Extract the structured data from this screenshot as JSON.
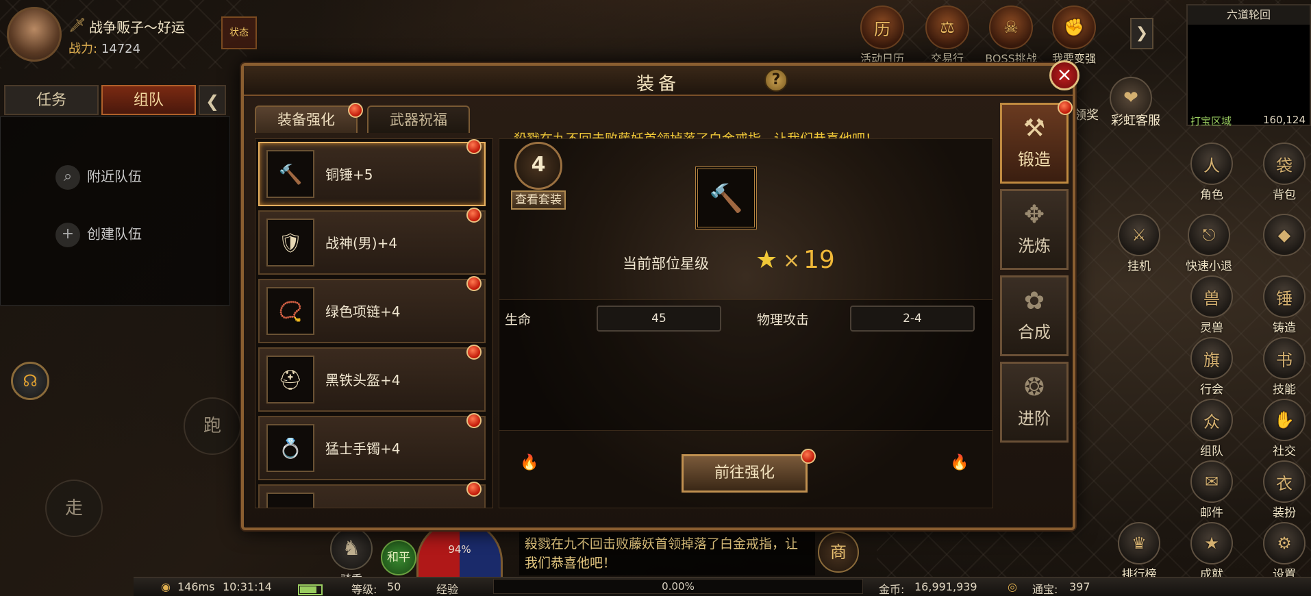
{
  "player": {
    "name": "战争贩子～好运",
    "power_label": "战力:",
    "power_value": "14724",
    "state_label": "状态"
  },
  "left_panel": {
    "tabs": [
      "任务",
      "组队"
    ],
    "collapse_icon": "chevron-left-icon",
    "team_actions": [
      {
        "icon": "search-icon",
        "label": "附近队伍"
      },
      {
        "icon": "plus-icon",
        "label": "创建队伍"
      }
    ],
    "run_label": "跑",
    "walk_label": "走"
  },
  "top_menu": [
    {
      "label": "活动日历",
      "icon": "calendar-icon"
    },
    {
      "label": "交易行",
      "icon": "scale-icon"
    },
    {
      "label": "BOSS挑战",
      "icon": "boss-icon"
    },
    {
      "label": "我要变强",
      "icon": "fist-icon"
    }
  ],
  "side_shortcuts_top": [
    {
      "label": "领奖"
    },
    {
      "label": "彩虹客服"
    }
  ],
  "minimap": {
    "title": "六道轮回",
    "zone": "打宝区域",
    "coords": "160,124"
  },
  "right_menu": [
    {
      "label": "角色",
      "icon": "character-icon"
    },
    {
      "label": "背包",
      "icon": "bag-icon"
    },
    {
      "label": "挂机",
      "icon": "auto-icon"
    },
    {
      "label": "快速小退",
      "icon": "exit-icon"
    },
    {
      "label": "",
      "icon": "diamond-icon"
    },
    {
      "label": "灵兽",
      "icon": "beast-icon"
    },
    {
      "label": "铸造",
      "icon": "forge-icon"
    },
    {
      "label": "行会",
      "icon": "guild-icon"
    },
    {
      "label": "技能",
      "icon": "skill-icon"
    },
    {
      "label": "组队",
      "icon": "team-icon"
    },
    {
      "label": "社交",
      "icon": "social-icon"
    },
    {
      "label": "邮件",
      "icon": "mail-icon"
    },
    {
      "label": "装扮",
      "icon": "outfit-icon"
    },
    {
      "label": "排行榜",
      "icon": "rank-icon"
    },
    {
      "label": "成就",
      "icon": "achievement-icon"
    },
    {
      "label": "设置",
      "icon": "gear-icon"
    }
  ],
  "panel": {
    "title": "装备",
    "tabs": [
      "装备强化",
      "武器祝福"
    ],
    "announcement": "殺戮在九不回击败藤妖首领掉落了白金戒指，让我们恭喜他吧！",
    "items": [
      {
        "name": "铜锤+5",
        "icon": "hammer-icon",
        "selected": true
      },
      {
        "name": "战神(男)+4",
        "icon": "armor-icon",
        "selected": false
      },
      {
        "name": "绿色项链+4",
        "icon": "necklace-icon",
        "selected": false
      },
      {
        "name": "黑铁头盔+4",
        "icon": "helmet-icon",
        "selected": false
      },
      {
        "name": "猛士手镯+4",
        "icon": "bracelet-icon",
        "selected": false
      },
      {
        "name": "",
        "icon": "item-icon",
        "selected": false
      }
    ],
    "suit": {
      "count": "4",
      "button": "查看套装"
    },
    "star": {
      "label": "当前部位星级",
      "multiplier": "×",
      "value": "19"
    },
    "stats": [
      {
        "label": "生命",
        "value": "45"
      },
      {
        "label": "物理攻击",
        "value": "2-4"
      }
    ],
    "go_button": "前往强化",
    "side_tabs": [
      {
        "label": "锻造",
        "active": true
      },
      {
        "label": "洗炼",
        "active": false
      },
      {
        "label": "合成",
        "active": false
      },
      {
        "label": "进阶",
        "active": false
      }
    ]
  },
  "bottom": {
    "ping": "146ms",
    "time": "10:31:14",
    "level_label": "等级:",
    "level": "50",
    "exp_label": "经验",
    "exp_value": "0.00%",
    "gold_label": "金币:",
    "gold": "16,991,939",
    "treasure_label": "通宝:",
    "treasure": "397",
    "mount_label": "骑乘",
    "peace_label": "和平",
    "hp_percent": "94%",
    "shop_label": "商",
    "chat_message": "殺戮在九不回击败藤妖首领掉落了白金戒指，让我们恭喜他吧！"
  },
  "colors": {
    "accent_gold": "#f0c838",
    "red_dot": "#c01808",
    "frame_bronze": "#8a5e30"
  }
}
